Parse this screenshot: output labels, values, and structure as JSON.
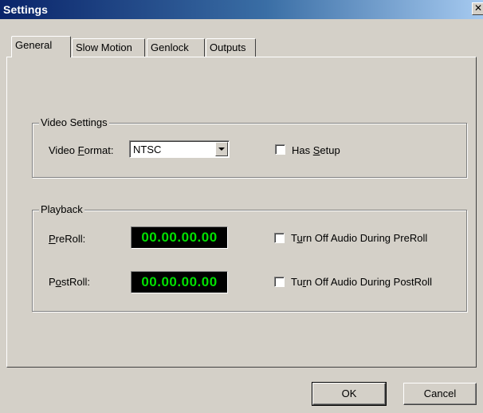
{
  "window": {
    "title": "Settings",
    "close_glyph": "✕"
  },
  "tabs": [
    {
      "label": "General",
      "active": true
    },
    {
      "label": "Slow Motion",
      "active": false
    },
    {
      "label": "Genlock",
      "active": false
    },
    {
      "label": "Outputs",
      "active": false
    }
  ],
  "video_settings": {
    "legend": "Video Settings",
    "format_label_pre": "Video ",
    "format_label_mnemonic": "F",
    "format_label_post": "ormat:",
    "format_value": "NTSC",
    "has_setup_pre": "Has ",
    "has_setup_mnemonic": "S",
    "has_setup_post": "etup",
    "has_setup_checked": false
  },
  "playback": {
    "legend": "Playback",
    "preroll_mnemonic": "P",
    "preroll_post": "reRoll:",
    "preroll_value": "00.00.00.00",
    "postroll_pre": "P",
    "postroll_mnemonic": "o",
    "postroll_post": "stRoll:",
    "postroll_value": "00.00.00.00",
    "audio_pre_a": "T",
    "audio_pre_mnemonic": "u",
    "audio_pre_b": "rn Off Audio During PreRoll",
    "audio_pre_checked": false,
    "audio_post_a": "Tu",
    "audio_post_mnemonic": "r",
    "audio_post_b": "n Off Audio During PostRoll",
    "audio_post_checked": false
  },
  "buttons": {
    "ok": "OK",
    "cancel": "Cancel"
  },
  "colors": {
    "timecode_text": "#00e000",
    "timecode_bg": "#000000",
    "title_bar": "#0a246a"
  }
}
